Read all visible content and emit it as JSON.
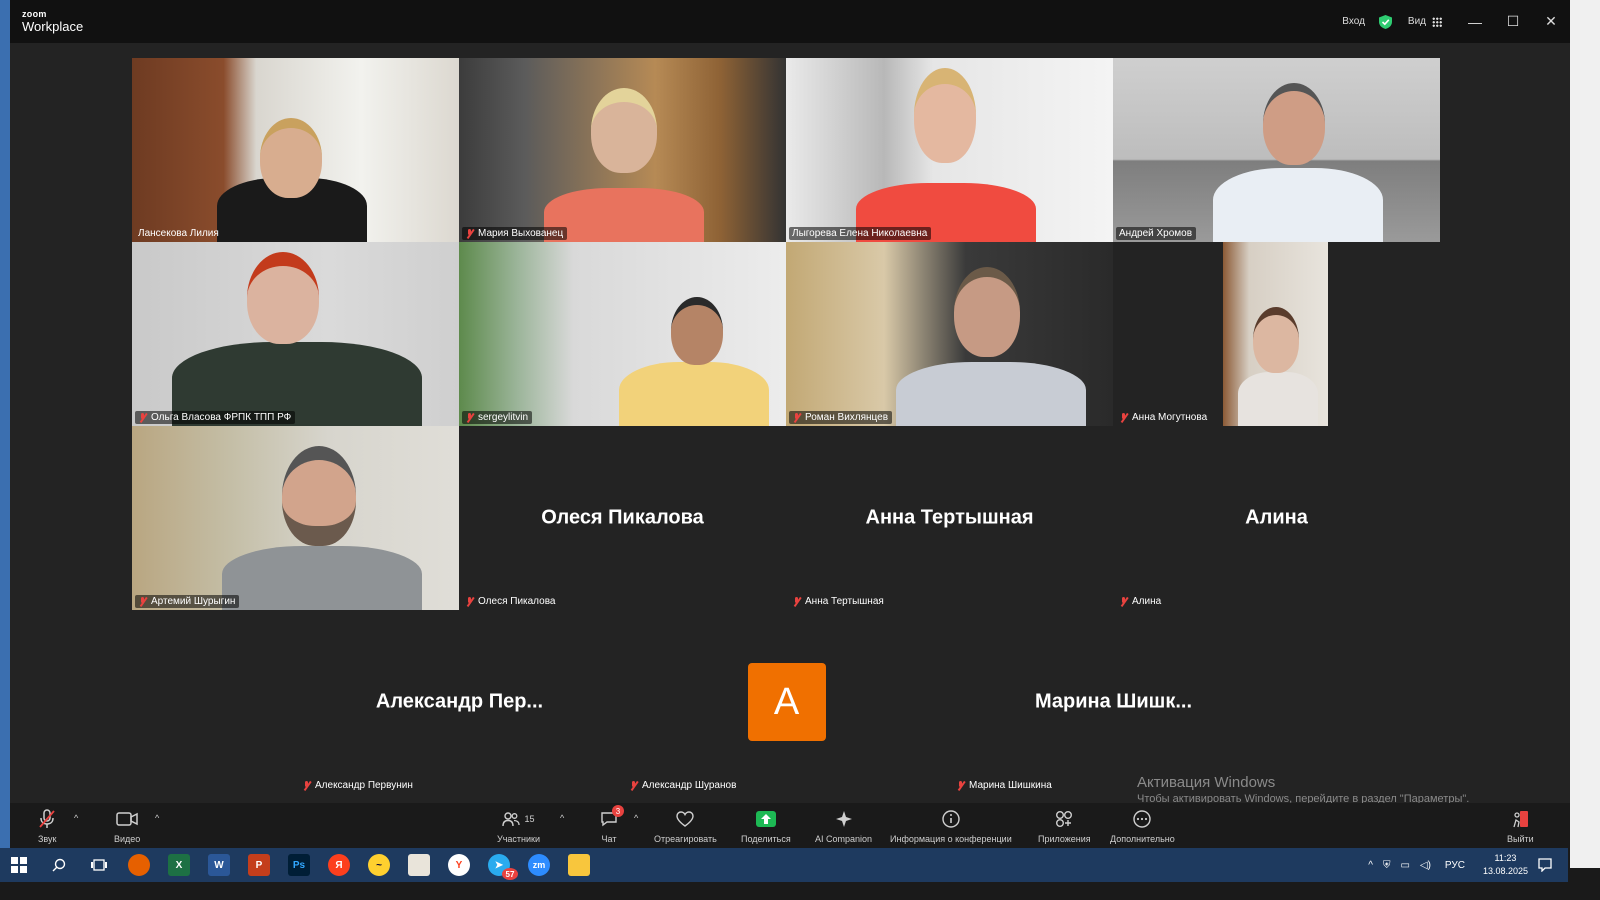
{
  "titlebar": {
    "brand_small": "zoom",
    "brand_big": "Workplace",
    "signin": "Вход",
    "view": "Вид"
  },
  "participants": [
    {
      "name": "Лансекова Лилия",
      "video": true
    },
    {
      "name": "Мария Выхованец",
      "video": true,
      "muted": true
    },
    {
      "name": "Лыгорева Елена Николаевна",
      "video": true
    },
    {
      "name": "Андрей Хромов",
      "video": true,
      "active": true
    },
    {
      "name": "Ольга Власова ФРПК ТПП РФ",
      "video": true,
      "muted": true
    },
    {
      "name": "sergeylitvin",
      "video": true,
      "muted": true
    },
    {
      "name": "Роман Вихлянцев",
      "video": true,
      "muted": true
    },
    {
      "name": "Анна Могутнова",
      "video": true,
      "muted": true
    },
    {
      "name": "Артемий Шурыгин",
      "video": true,
      "muted": true
    },
    {
      "name": "Олеся Пикалова",
      "display": "Олеся Пикалова",
      "muted": true
    },
    {
      "name": "Анна Тертышная",
      "display": "Анна Тертышная",
      "muted": true
    },
    {
      "name": "Алина",
      "display": "Алина",
      "muted": true
    },
    {
      "name": "Александр Первунин",
      "display": "Александр Пер...",
      "muted": true
    },
    {
      "name": "Александр Шуранов",
      "avatar_letter": "А",
      "muted": true
    },
    {
      "name": "Марина Шишкина",
      "display": "Марина Шишк...",
      "muted": true
    }
  ],
  "toolbar": {
    "audio": "Звук",
    "video": "Видео",
    "participants": "Участники",
    "participants_count": "15",
    "chat": "Чат",
    "chat_badge": "3",
    "react": "Отреагировать",
    "share": "Поделиться",
    "ai": "AI Companion",
    "info": "Информация о конференции",
    "apps": "Приложения",
    "more": "Дополнительно",
    "leave": "Выйти"
  },
  "watermark": {
    "line1": "Активация Windows",
    "line2": "Чтобы активировать Windows, перейдите в раздел \"Параметры\"."
  },
  "taskbar": {
    "lang": "РУС",
    "time": "11:23",
    "date": "13.08.2025",
    "telegram_badge": "57",
    "apps": [
      "start-icon",
      "search-icon",
      "taskview-icon",
      "firefox-icon",
      "excel-icon",
      "word-icon",
      "powerpoint-icon",
      "photoshop-icon",
      "yandex-icon",
      "miro-icon",
      "calendar-icon",
      "yandex-browser-icon",
      "telegram-icon",
      "zoom-icon",
      "explorer-icon"
    ]
  },
  "colors": {
    "active_speaker": "#3ddc84",
    "avatar_bg": "#f07000",
    "mute_red": "#e8423f"
  }
}
